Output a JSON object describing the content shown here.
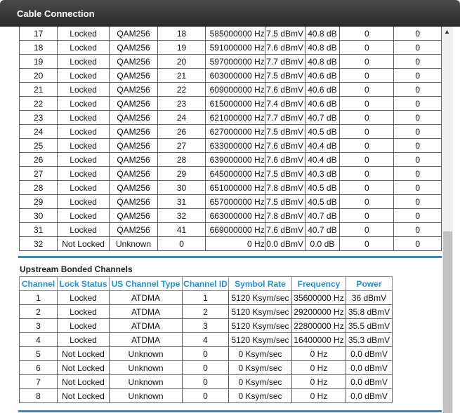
{
  "window": {
    "title": "Cable Connection"
  },
  "downstream": {
    "rows": [
      [
        "17",
        "Locked",
        "QAM256",
        "18",
        "585000000 Hz",
        "7.5 dBmV",
        "40.8 dB",
        "0",
        "0"
      ],
      [
        "18",
        "Locked",
        "QAM256",
        "19",
        "591000000 Hz",
        "7.6 dBmV",
        "40.8 dB",
        "0",
        "0"
      ],
      [
        "19",
        "Locked",
        "QAM256",
        "20",
        "597000000 Hz",
        "7.7 dBmV",
        "40.8 dB",
        "0",
        "0"
      ],
      [
        "20",
        "Locked",
        "QAM256",
        "21",
        "603000000 Hz",
        "7.5 dBmV",
        "40.6 dB",
        "0",
        "0"
      ],
      [
        "21",
        "Locked",
        "QAM256",
        "22",
        "609000000 Hz",
        "7.6 dBmV",
        "40.6 dB",
        "0",
        "0"
      ],
      [
        "22",
        "Locked",
        "QAM256",
        "23",
        "615000000 Hz",
        "7.4 dBmV",
        "40.6 dB",
        "0",
        "0"
      ],
      [
        "23",
        "Locked",
        "QAM256",
        "24",
        "621000000 Hz",
        "7.7 dBmV",
        "40.7 dB",
        "0",
        "0"
      ],
      [
        "24",
        "Locked",
        "QAM256",
        "26",
        "627000000 Hz",
        "7.5 dBmV",
        "40.5 dB",
        "0",
        "0"
      ],
      [
        "25",
        "Locked",
        "QAM256",
        "27",
        "633000000 Hz",
        "7.6 dBmV",
        "40.4 dB",
        "0",
        "0"
      ],
      [
        "26",
        "Locked",
        "QAM256",
        "28",
        "639000000 Hz",
        "7.6 dBmV",
        "40.4 dB",
        "0",
        "0"
      ],
      [
        "27",
        "Locked",
        "QAM256",
        "29",
        "645000000 Hz",
        "7.5 dBmV",
        "40.3 dB",
        "0",
        "0"
      ],
      [
        "28",
        "Locked",
        "QAM256",
        "30",
        "651000000 Hz",
        "7.8 dBmV",
        "40.5 dB",
        "0",
        "0"
      ],
      [
        "29",
        "Locked",
        "QAM256",
        "31",
        "657000000 Hz",
        "7.5 dBmV",
        "40.5 dB",
        "0",
        "0"
      ],
      [
        "30",
        "Locked",
        "QAM256",
        "32",
        "663000000 Hz",
        "7.8 dBmV",
        "40.7 dB",
        "0",
        "0"
      ],
      [
        "31",
        "Locked",
        "QAM256",
        "41",
        "669000000 Hz",
        "7.6 dBmV",
        "40.7 dB",
        "0",
        "0"
      ],
      [
        "32",
        "Not Locked",
        "Unknown",
        "0",
        "0 Hz",
        "0.0 dBmV",
        "0.0 dB",
        "0",
        "0"
      ]
    ]
  },
  "upstream": {
    "heading": "Upstream Bonded Channels",
    "headers": [
      "Channel",
      "Lock Status",
      "US Channel Type",
      "Channel ID",
      "Symbol Rate",
      "Frequency",
      "Power"
    ],
    "rows": [
      [
        "1",
        "Locked",
        "ATDMA",
        "1",
        "5120 Ksym/sec",
        "35600000 Hz",
        "36 dBmV"
      ],
      [
        "2",
        "Locked",
        "ATDMA",
        "2",
        "5120 Ksym/sec",
        "29200000 Hz",
        "35.8 dBmV"
      ],
      [
        "3",
        "Locked",
        "ATDMA",
        "3",
        "5120 Ksym/sec",
        "22800000 Hz",
        "35.5 dBmV"
      ],
      [
        "4",
        "Locked",
        "ATDMA",
        "4",
        "5120 Ksym/sec",
        "16400000 Hz",
        "35.3 dBmV"
      ],
      [
        "5",
        "Not Locked",
        "Unknown",
        "0",
        "0 Ksym/sec",
        "0 Hz",
        "0.0 dBmV"
      ],
      [
        "6",
        "Not Locked",
        "Unknown",
        "0",
        "0 Ksym/sec",
        "0 Hz",
        "0.0 dBmV"
      ],
      [
        "7",
        "Not Locked",
        "Unknown",
        "0",
        "0 Ksym/sec",
        "0 Hz",
        "0.0 dBmV"
      ],
      [
        "8",
        "Not Locked",
        "Unknown",
        "0",
        "0 Ksym/sec",
        "0 Hz",
        "0.0 dBmV"
      ]
    ]
  },
  "scrollbar": {
    "up_arrow": "▲"
  },
  "colors": {
    "accent": "#2a8fc9",
    "titlebar": "#3a3a3a"
  }
}
